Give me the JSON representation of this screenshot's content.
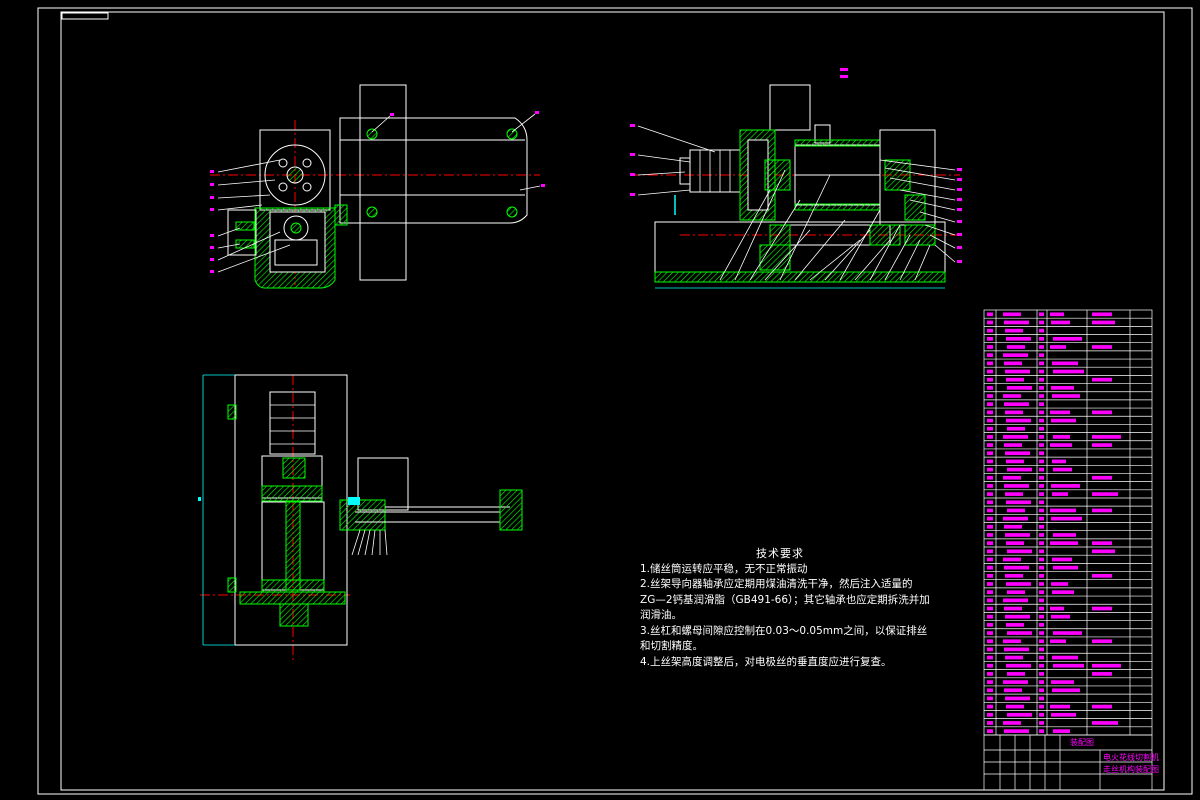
{
  "drawing": {
    "tech_requirements": {
      "title": "技术要求",
      "lines": [
        "1.储丝筒运转应平稳，无不正常振动",
        "2.丝架导向器轴承应定期用煤油清洗干净，然后注入适量的",
        "ZG—2钙基润滑脂（GB491-66）；其它轴承也应定期拆洗并加",
        "润滑油。",
        "3.丝杠和螺母间隙应控制在0.03～0.05mm之间，以保证排丝",
        "和切割精度。",
        "4.上丝架高度调整后，对电极丝的垂直度应进行复查。"
      ]
    },
    "title_block": {
      "drawing_title_line1": "电火花线切割机",
      "drawing_title_line2": "走丝机构装配图",
      "center_label": "装配图"
    },
    "colors": {
      "background": "#000000",
      "outline": "#ffffff",
      "section_hatch": "#00ff00",
      "center_line": "#ff0000",
      "annotation": "#ff00ff",
      "leader": "#ffffff",
      "dimension": "#00ffff",
      "table_text": "#ff00ff"
    }
  }
}
